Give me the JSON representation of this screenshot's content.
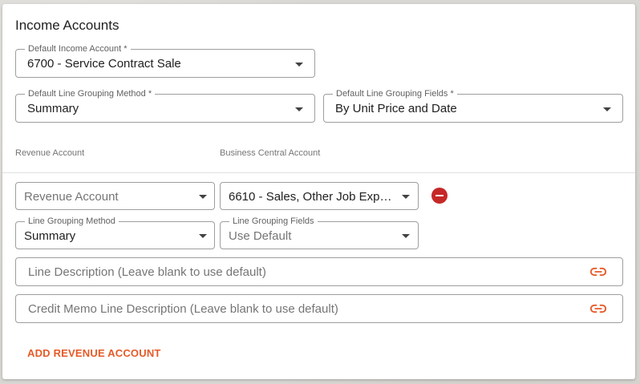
{
  "section": {
    "title": "Income Accounts"
  },
  "default_income_account": {
    "label": "Default Income Account *",
    "value": "6700 - Service Contract Sale"
  },
  "default_line_grouping_method": {
    "label": "Default Line Grouping Method *",
    "value": "Summary"
  },
  "default_line_grouping_fields": {
    "label": "Default Line Grouping Fields *",
    "value": "By Unit Price and Date"
  },
  "columns": {
    "revenue_account": "Revenue Account",
    "business_central_account": "Business Central Account"
  },
  "row": {
    "revenue_account_placeholder": "Revenue Account",
    "business_central_account_value": "6610 - Sales, Other Job Expen...",
    "line_grouping_method": {
      "label": "Line Grouping Method",
      "value": "Summary"
    },
    "line_grouping_fields": {
      "label": "Line Grouping Fields",
      "value": "Use Default"
    },
    "line_description_placeholder": "Line Description (Leave blank to use default)",
    "credit_memo_description_placeholder": "Credit Memo Line Description (Leave blank to use default)"
  },
  "actions": {
    "add_revenue_account": "ADD REVENUE ACCOUNT"
  },
  "colors": {
    "accent": "#e65a28",
    "remove": "#c62828",
    "border": "#9e9e9e"
  },
  "icons": {
    "select_caret": "chevron-down-icon",
    "remove": "remove-circle-icon",
    "link": "link-icon"
  }
}
